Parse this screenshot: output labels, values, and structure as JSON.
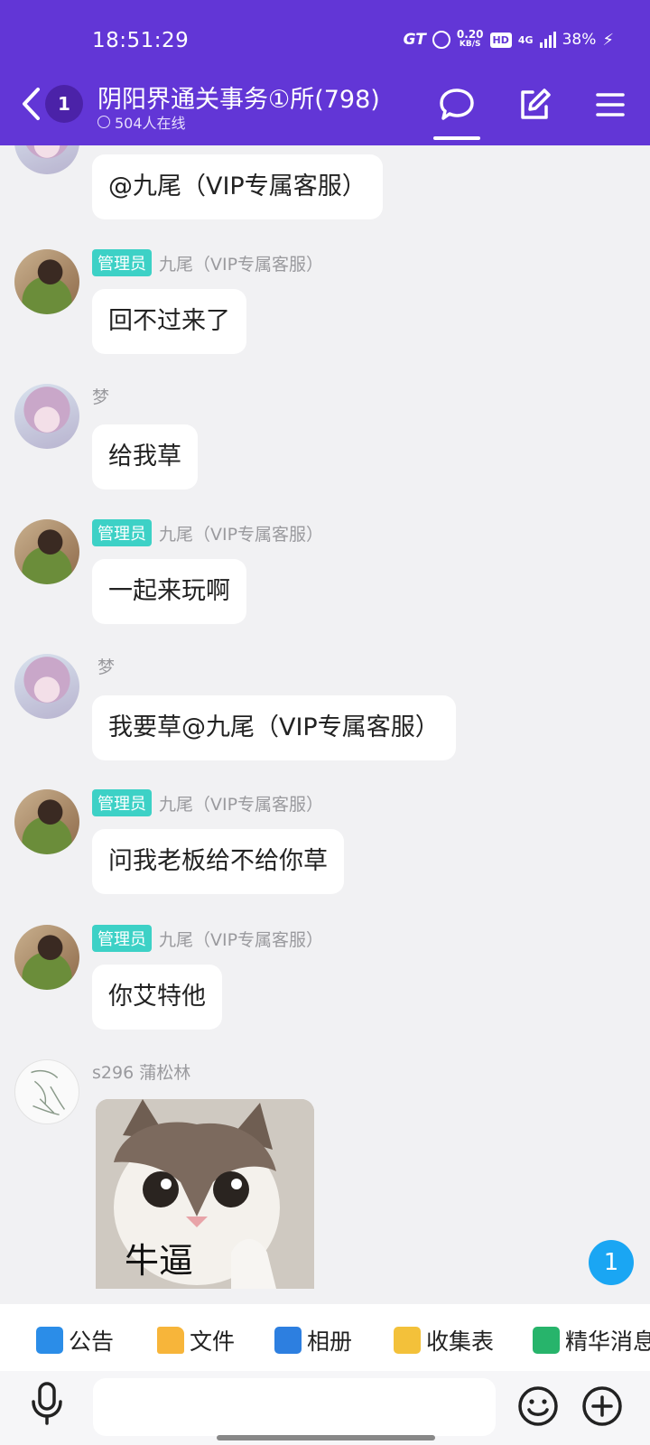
{
  "status_bar": {
    "time": "18:51:29",
    "speed_value": "0.20",
    "speed_unit": "KB/S",
    "hd": "HD",
    "network": "4G",
    "battery": "38%"
  },
  "header": {
    "unread_count": "1",
    "title": "阴阳界通关事务①所(798)",
    "online": "504人在线",
    "colors": {
      "header_bg": "#6236d6",
      "admin_badge": "#3dd1c6"
    }
  },
  "messages": [
    {
      "avatar": "meng-avatar",
      "text": "@九尾（VIP专属客服）"
    },
    {
      "role": "管理员",
      "sender": "九尾（VIP专属客服）",
      "text": "回不过来了"
    },
    {
      "sender": "梦",
      "text": "给我草"
    },
    {
      "role": "管理员",
      "sender": "九尾（VIP专属客服）",
      "text": "一起来玩啊"
    },
    {
      "sender": "梦",
      "text": "我要草@九尾（VIP专属客服）"
    },
    {
      "role": "管理员",
      "sender": "九尾（VIP专属客服）",
      "text": "问我老板给不给你草"
    },
    {
      "role": "管理员",
      "sender": "九尾（VIP专属客服）",
      "text": "你艾特他"
    },
    {
      "sender": "s296 蒲松林",
      "sticker_text": "牛逼"
    }
  ],
  "new_message_badge": "1",
  "toolbar": {
    "notice": "公告",
    "files": "文件",
    "album": "相册",
    "form": "收集表",
    "digest": "精华消息"
  },
  "input": {
    "placeholder": ""
  }
}
